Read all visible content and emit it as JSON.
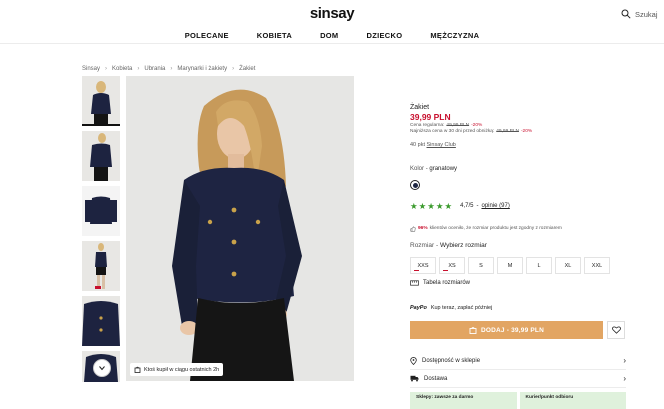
{
  "header": {
    "logo": "sinsay",
    "search_label": "Szukaj",
    "nav": [
      "POLECANE",
      "KOBIETA",
      "DOM",
      "DZIECKO",
      "MĘŻCZYZNA"
    ]
  },
  "breadcrumb": [
    "Sinsay",
    "Kobieta",
    "Ubrania",
    "Marynarki i żakiety",
    "Żakiet"
  ],
  "gallery": {
    "stock_badge": "Ktoś kupił w ciągu ostatnich 2h"
  },
  "product": {
    "name": "Żakiet",
    "price": "39,99 PLN",
    "regular_label": "Cena regularna:",
    "regular_price": "49,99 PLN",
    "regular_discount": "-20%",
    "lowest_label": "Najniższa cena w 30 dni przed obniżką:",
    "lowest_price": "49,99 PLN",
    "lowest_discount": "-20%",
    "points_prefix": "40 pkt",
    "points_link": "Sinsay Club",
    "color_label": "Kolor",
    "color_value": "granatowy",
    "color_swatch": "#1c2440",
    "rating_value": "4,7/5",
    "rating_link": "opinie (97)",
    "fit_pct": "96%",
    "fit_text": "klientów oceniło, że rozmiar produktu jest zgodny z rozmiarem",
    "size_label": "Rozmiar",
    "size_value": "Wybierz rozmiar",
    "sizes": [
      "XXS",
      "XS",
      "S",
      "M",
      "L",
      "XL",
      "XXL"
    ],
    "size_table": "Tabela rozmiarów",
    "paypo_logo": "PayPo",
    "paypo_text": "Kup teraz, zapłać później",
    "add_to_cart": "DODAJ - 39,99 PLN",
    "availability": "Dostępność w sklepie",
    "delivery": "Dostawa",
    "delivery_box_1": "Sklepy: zawsze za darmo",
    "delivery_box_2": "Kurier/punkt odbioru"
  },
  "colors": {
    "accent_price": "#c8102e",
    "add_button": "#e2a563",
    "rating_stars": "#3a9a2c",
    "delivery_box": "#dff1dc"
  }
}
